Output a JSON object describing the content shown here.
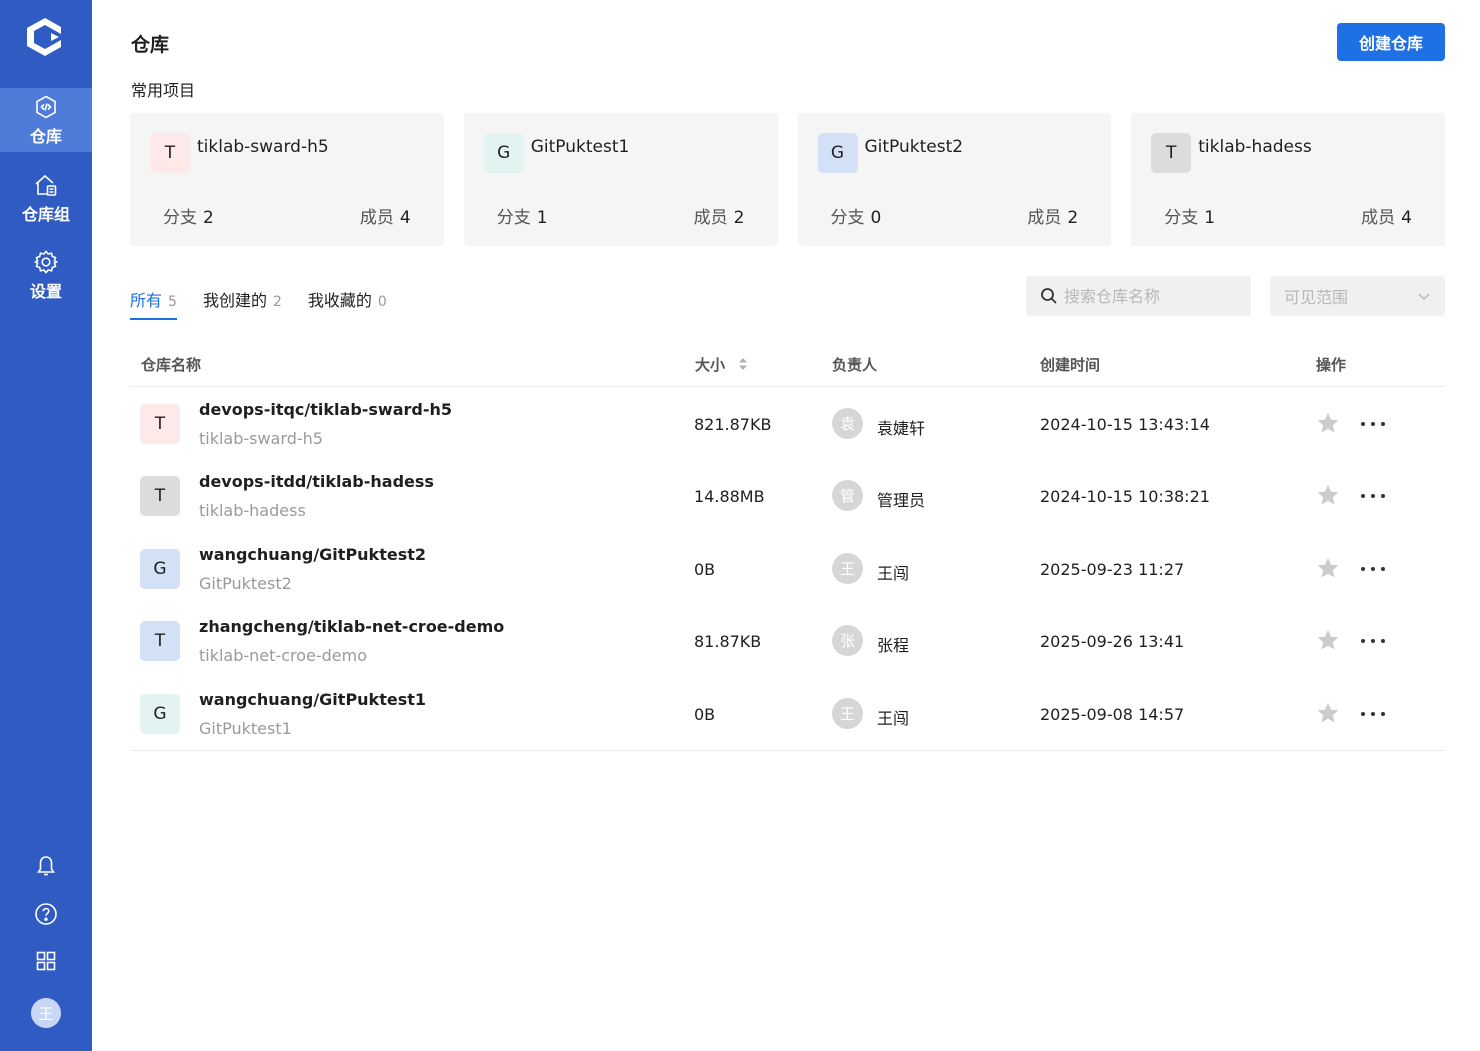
{
  "sidebar": {
    "items": [
      {
        "label": "仓库",
        "icon": "repository-icon",
        "active": true
      },
      {
        "label": "仓库组",
        "icon": "repository-group-icon",
        "active": false
      },
      {
        "label": "设置",
        "icon": "settings-gear-icon",
        "active": false
      }
    ],
    "user_avatar": "王"
  },
  "header": {
    "title": "仓库",
    "create_button": "创建仓库"
  },
  "recent": {
    "title": "常用项目",
    "branch_label": "分支",
    "member_label": "成员",
    "cards": [
      {
        "initial": "T",
        "name": "tiklab-sward-h5",
        "branches": "2",
        "members": "4",
        "color": "#fde8ea"
      },
      {
        "initial": "G",
        "name": "GitPuktest1",
        "branches": "1",
        "members": "2",
        "color": "#e3f3f1"
      },
      {
        "initial": "G",
        "name": "GitPuktest2",
        "branches": "0",
        "members": "2",
        "color": "#d3e1f7"
      },
      {
        "initial": "T",
        "name": "tiklab-hadess",
        "branches": "1",
        "members": "4",
        "color": "#dcdcdc"
      }
    ]
  },
  "tabs": [
    {
      "label": "所有",
      "count": "5",
      "active": true
    },
    {
      "label": "我创建的",
      "count": "2",
      "active": false
    },
    {
      "label": "我收藏的",
      "count": "0",
      "active": false
    }
  ],
  "search": {
    "placeholder": "搜索仓库名称"
  },
  "visibility_select": {
    "placeholder": "可见范围"
  },
  "table": {
    "columns": {
      "name": "仓库名称",
      "size": "大小",
      "owner": "负责人",
      "created": "创建时间",
      "actions": "操作"
    },
    "rows": [
      {
        "initial": "T",
        "color": "#fde8ea",
        "path": "devops-itqc/tiklab-sward-h5",
        "name": "tiklab-sward-h5",
        "size": "821.87KB",
        "owner_initial": "袁",
        "owner": "袁婕轩",
        "created": "2024-10-15 13:43:14"
      },
      {
        "initial": "T",
        "color": "#dcdcdc",
        "path": "devops-itdd/tiklab-hadess",
        "name": "tiklab-hadess",
        "size": "14.88MB",
        "owner_initial": "管",
        "owner": "管理员",
        "created": "2024-10-15 10:38:21"
      },
      {
        "initial": "G",
        "color": "#d3e1f7",
        "path": "wangchuang/GitPuktest2",
        "name": "GitPuktest2",
        "size": "0B",
        "owner_initial": "王",
        "owner": "王闯",
        "created": "2025-09-23 11:27"
      },
      {
        "initial": "T",
        "color": "#d3e1f7",
        "path": "zhangcheng/tiklab-net-croe-demo",
        "name": "tiklab-net-croe-demo",
        "size": "81.87KB",
        "owner_initial": "张",
        "owner": "张程",
        "created": "2025-09-26 13:41"
      },
      {
        "initial": "G",
        "color": "#e3f3f1",
        "path": "wangchuang/GitPuktest1",
        "name": "GitPuktest1",
        "size": "0B",
        "owner_initial": "王",
        "owner": "王闯",
        "created": "2025-09-08 14:57"
      }
    ]
  },
  "colors": {
    "sidebar": "#2f5bc2",
    "sidebar_active": "#4f7bd9",
    "primary": "#1f6fe5"
  }
}
